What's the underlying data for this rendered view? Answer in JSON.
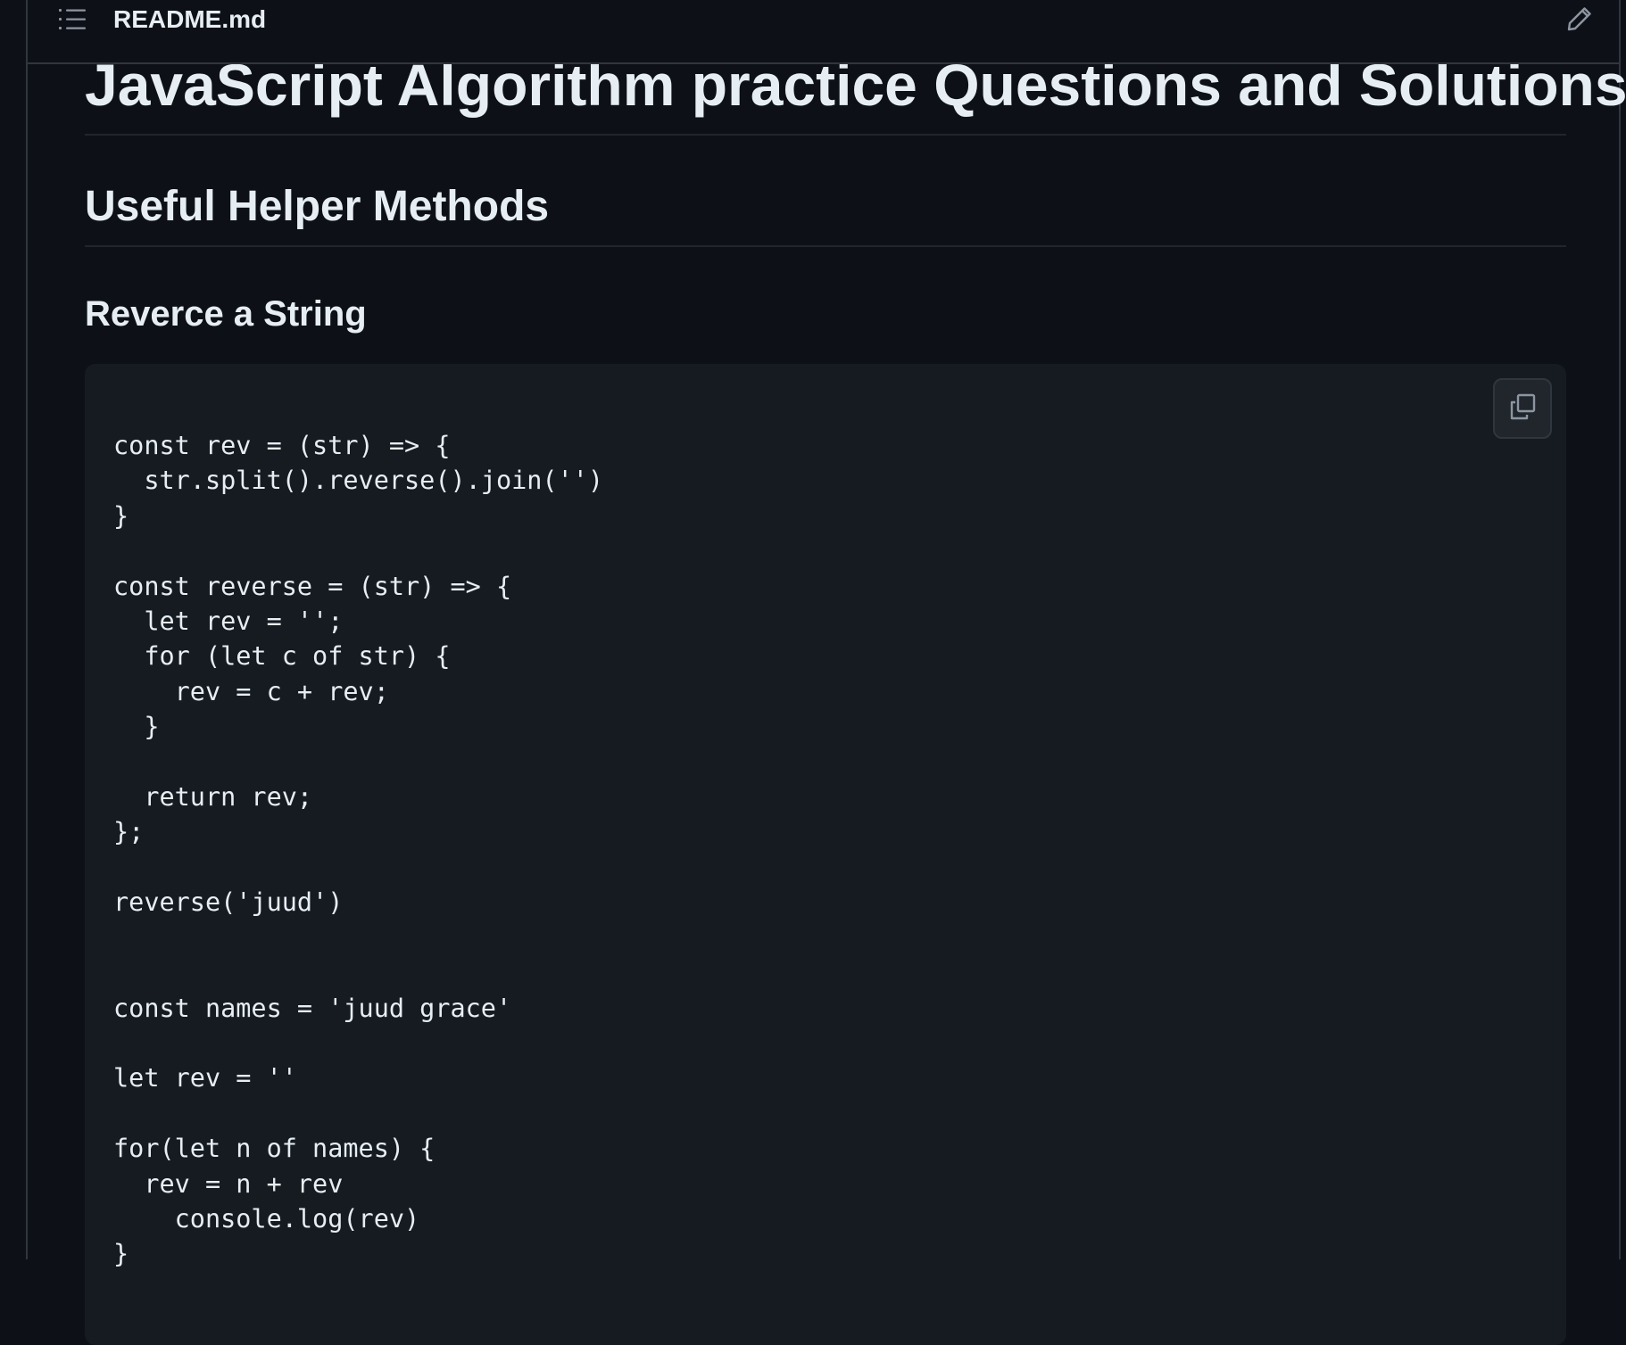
{
  "file_header": {
    "toc_icon": "list-unordered-icon",
    "file_name": "README.md",
    "edit_icon": "pencil-icon"
  },
  "readme": {
    "title": "JavaScript Algorithm practice Questions and Solutions",
    "section_heading": "Useful Helper Methods",
    "subsection_heading": "Reverce a String",
    "code_block": {
      "copy_icon": "copy-icon",
      "code": "const rev = (str) => {\n  str.split().reverse().join('')\n}\n\nconst reverse = (str) => {\n  let rev = '';\n  for (let c of str) {\n    rev = c + rev;\n  }\n\n  return rev;\n};\n\nreverse('juud')\n\n\nconst names = 'juud grace'\n\nlet rev = ''\n\nfor(let n of names) {\n  rev = n + rev\n    console.log(rev)\n}"
    }
  },
  "colors": {
    "page_background": "#0d1117",
    "code_background": "#161b22",
    "border": "#30363d",
    "text": "#e6edf3",
    "icon": "#8d96a0"
  }
}
